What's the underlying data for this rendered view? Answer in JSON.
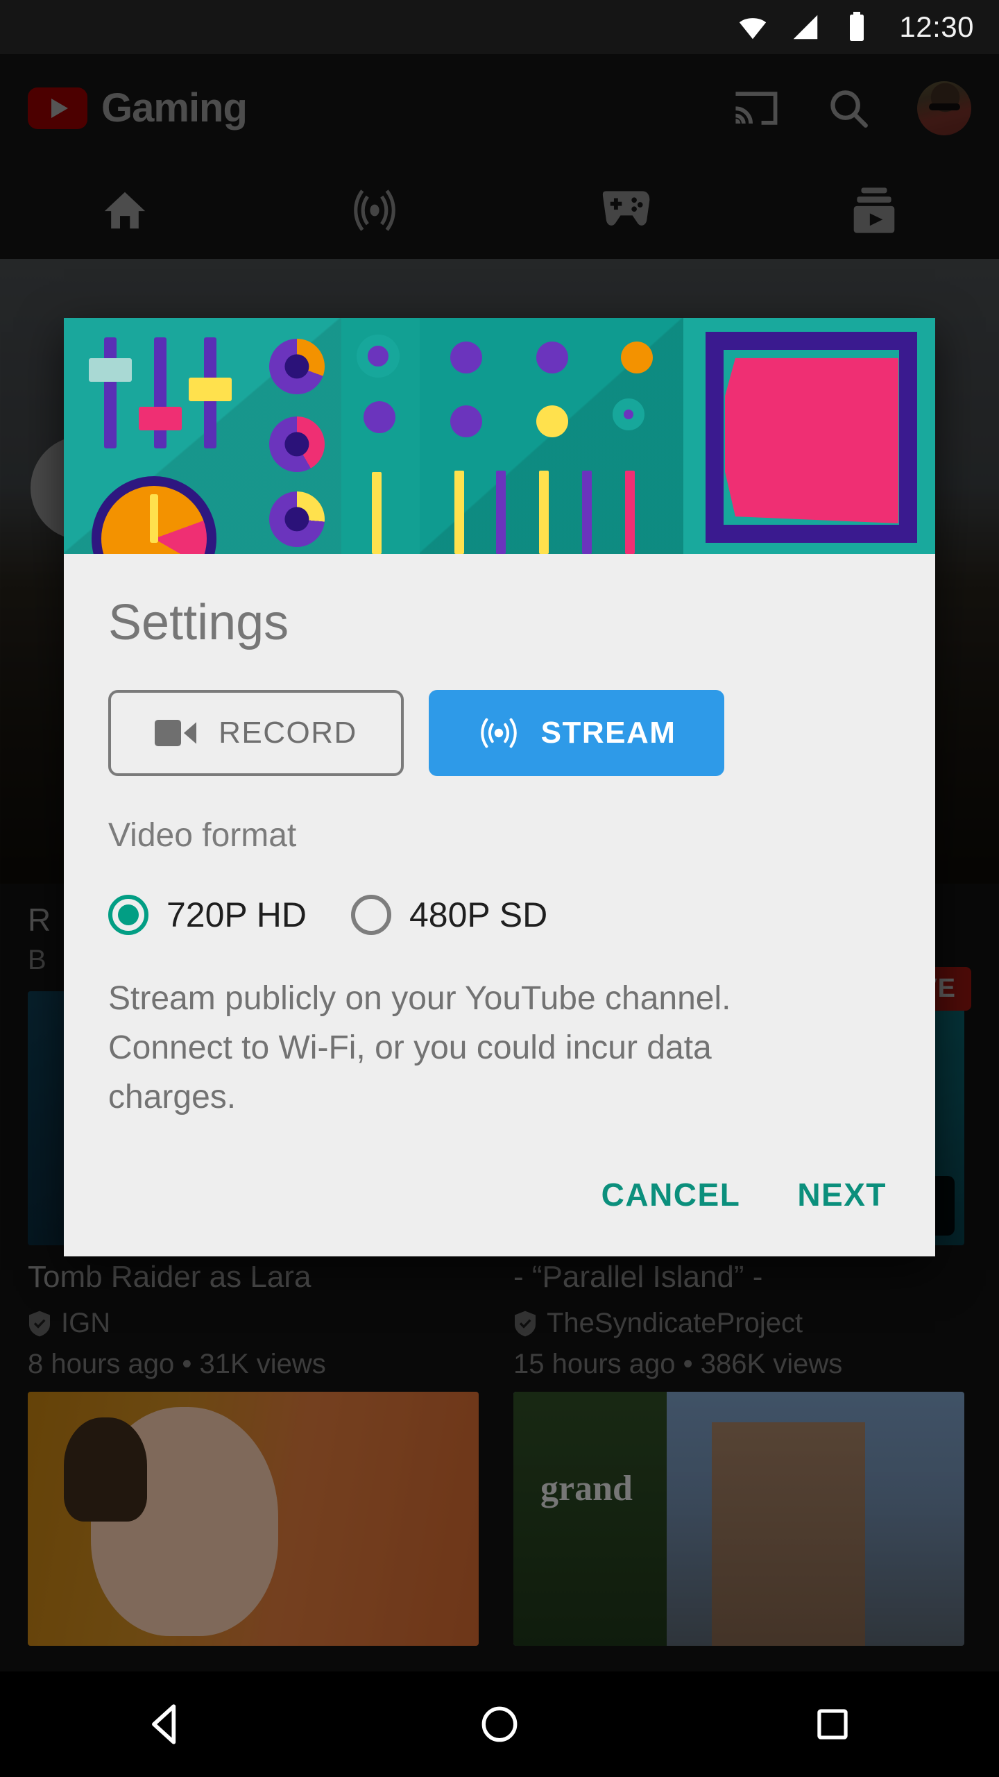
{
  "status_bar": {
    "time": "12:30",
    "icons": [
      "wifi-icon",
      "cellular-signal-icon",
      "battery-icon"
    ]
  },
  "app": {
    "brand_name": "Gaming",
    "logo_icon": "youtube-logo-icon",
    "actions": [
      {
        "name": "cast-icon",
        "label": "Cast"
      },
      {
        "name": "search-icon",
        "label": "Search"
      },
      {
        "name": "avatar",
        "label": "Account"
      }
    ],
    "tabs": [
      {
        "name": "tab-home",
        "icon": "home-icon",
        "label": "Home"
      },
      {
        "name": "tab-live",
        "icon": "broadcast-icon",
        "label": "Live"
      },
      {
        "name": "tab-games",
        "icon": "gamepad-icon",
        "label": "Games"
      },
      {
        "name": "tab-library",
        "icon": "library-icon",
        "label": "Library"
      }
    ],
    "live_badge": "LIVE",
    "feed": {
      "hero_title_fragment": "R",
      "hero_sub_fragment": "B",
      "cards": [
        {
          "title": "Tomb Raider as Lara",
          "channel": "IGN",
          "meta": "8 hours ago • 31K views"
        },
        {
          "title": "- “Parallel Island” -",
          "channel": "TheSyndicateProject",
          "meta": "15 hours ago • 386K views"
        }
      ],
      "bottom_thumbs": [
        {
          "name": "thumbnail-cartoon",
          "caption": ""
        },
        {
          "name": "thumbnail-gta",
          "caption": "grand"
        }
      ]
    }
  },
  "dialog": {
    "hero_image_name": "settings-illustration",
    "title": "Settings",
    "modes": [
      {
        "name": "record-button",
        "label": "RECORD",
        "icon": "video-camera-icon",
        "selected": false
      },
      {
        "name": "stream-button",
        "label": "STREAM",
        "icon": "broadcast-icon",
        "selected": true
      }
    ],
    "video_format": {
      "label": "Video format",
      "options": [
        {
          "label": "720P HD",
          "selected": true
        },
        {
          "label": "480P SD",
          "selected": false
        }
      ]
    },
    "description": "Stream publicly on your YouTube channel. Connect to Wi-Fi, or you could incur data charges.",
    "actions": [
      {
        "name": "cancel-button",
        "label": "CANCEL"
      },
      {
        "name": "next-button",
        "label": "NEXT"
      }
    ]
  },
  "nav_bar": {
    "buttons": [
      {
        "name": "back-button",
        "icon": "back-triangle-icon"
      },
      {
        "name": "home-button",
        "icon": "home-circle-icon"
      },
      {
        "name": "recents-button",
        "icon": "recents-square-icon"
      }
    ]
  },
  "colors": {
    "accent_teal": "#029e84",
    "stream_blue": "#2e9ae8",
    "dialog_bg": "#eeeeee",
    "app_bg": "#121212",
    "live_red": "#8d1410"
  }
}
